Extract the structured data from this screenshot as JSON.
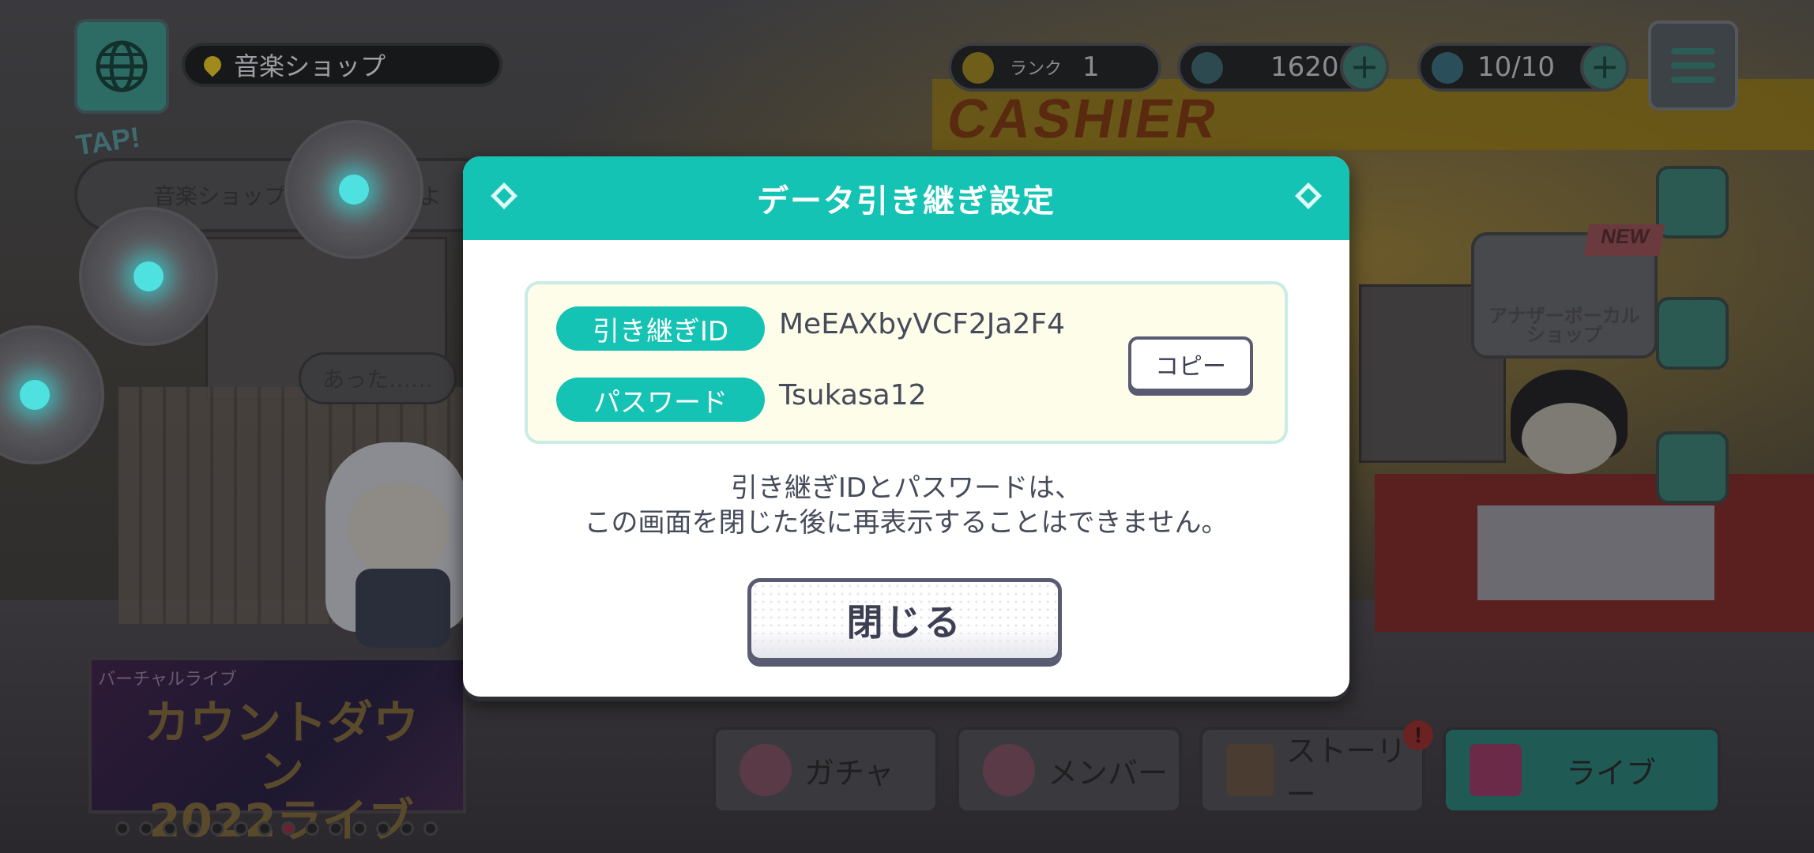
{
  "background": {
    "location": "音楽ショップ",
    "rank_label": "ランク",
    "rank_value": "1",
    "crystals": "1620",
    "stamina": "10/10",
    "tap_label": "TAP!",
    "speech_text": "音楽ショップを楽曲交換しよ",
    "speech2_text": "あった……",
    "sign_text": "CASHIER",
    "new_label": "NEW",
    "shop_bubble": "アナザーボーカル\nショップ",
    "banner_tag": "バーチャルライブ",
    "banner_title": "カウントダウン\n2022ライブ",
    "nav": [
      {
        "label": "ガチャ"
      },
      {
        "label": "メンバー"
      },
      {
        "label": "ストーリー"
      },
      {
        "label": "ライブ"
      }
    ],
    "alert_badge": "!",
    "carousel_dots": 14,
    "carousel_active_index": 7
  },
  "modal": {
    "title": "データ引き継ぎ設定",
    "id_label": "引き継ぎID",
    "id_value": "MeEAXbyVCF2Ja2F4",
    "password_label": "パスワード",
    "password_value": "Tsukasa12",
    "copy_label": "コピー",
    "notice_line1": "引き継ぎIDとパスワードは、",
    "notice_line2": "この画面を閉じた後に再表示することはできません。",
    "close_label": "閉じる"
  },
  "colors": {
    "accent": "#14c3b3",
    "button_border": "#595b72",
    "info_bg": "#fdfde9",
    "text": "#464b5a"
  }
}
